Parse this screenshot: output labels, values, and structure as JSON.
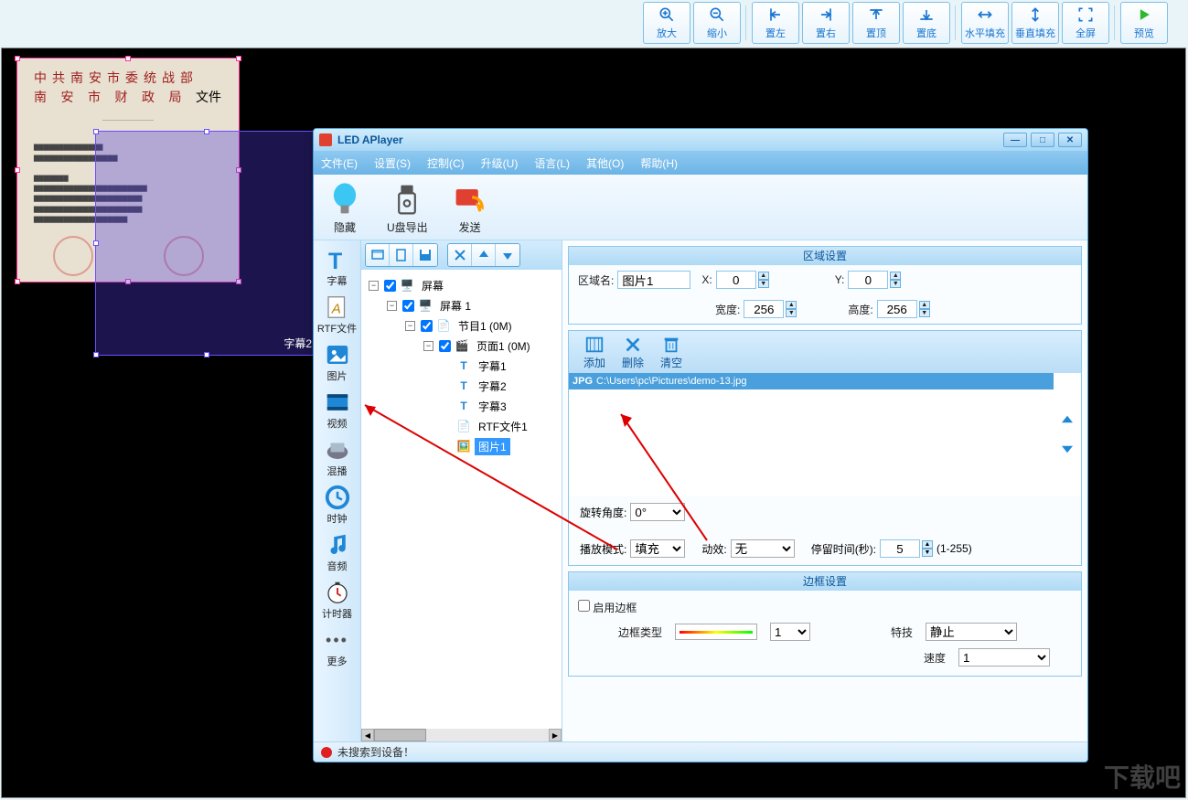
{
  "top_toolbar": {
    "zoom_in": "放大",
    "zoom_out": "缩小",
    "align_left": "置左",
    "align_right": "置右",
    "align_top": "置顶",
    "align_bottom": "置底",
    "fill_h": "水平填充",
    "fill_v": "垂直填充",
    "full": "全屏",
    "preview": "预览"
  },
  "canvas": {
    "subtitle2_label": "字幕2"
  },
  "app": {
    "title": "LED APlayer",
    "menus": {
      "file": "文件(E)",
      "settings": "设置(S)",
      "control": "控制(C)",
      "upgrade": "升级(U)",
      "language": "语言(L)",
      "other": "其他(O)",
      "help": "帮助(H)"
    },
    "main_tools": {
      "hide": "隐藏",
      "usb_export": "U盘导出",
      "send": "发送"
    },
    "palette": [
      "字幕",
      "RTF文件",
      "图片",
      "视频",
      "混播",
      "时钟",
      "音频",
      "计时器",
      "更多"
    ],
    "tree": {
      "screen": "屏幕",
      "screen1": "屏幕 1",
      "program1": "节目1 (0M)",
      "page1": "页面1 (0M)",
      "sub1": "字幕1",
      "sub2": "字幕2",
      "sub3": "字幕3",
      "rtf1": "RTF文件1",
      "img1": "图片1"
    },
    "section_area": {
      "title": "区域设置",
      "name_label": "区域名:",
      "name_value": "图片1",
      "x_label": "X:",
      "x_value": "0",
      "y_label": "Y:",
      "y_value": "0",
      "w_label": "宽度:",
      "w_value": "256",
      "h_label": "高度:",
      "h_value": "256"
    },
    "file_ops": {
      "add": "添加",
      "delete": "删除",
      "clear": "清空"
    },
    "file_item": {
      "tag": "JPG",
      "path": "C:\\Users\\pc\\Pictures\\demo-13.jpg"
    },
    "playback": {
      "rotate_label": "旋转角度:",
      "rotate_value": "0°",
      "mode_label": "播放模式:",
      "mode_value": "填充",
      "effect_label": "动效:",
      "effect_value": "无",
      "dwell_label": "停留时间(秒):",
      "dwell_value": "5",
      "dwell_range": "(1-255)"
    },
    "section_border": {
      "title": "边框设置",
      "enable": "启用边框",
      "type_label": "边框类型",
      "type_value": "1",
      "trick_label": "特技",
      "trick_value": "静止",
      "speed_label": "速度",
      "speed_value": "1"
    },
    "status": "未搜索到设备！"
  },
  "watermark": "下载吧"
}
